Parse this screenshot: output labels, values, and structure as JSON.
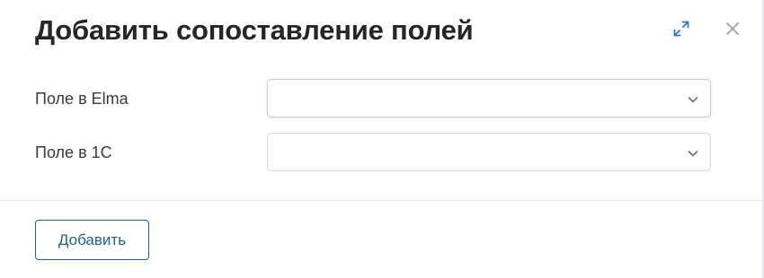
{
  "dialog": {
    "title": "Добавить сопоставление полей",
    "expand_icon": "expand-arrows-icon",
    "close_icon": "close-icon"
  },
  "fields": [
    {
      "label": "Поле в Elma",
      "value": "",
      "focused": true
    },
    {
      "label": "Поле в 1С",
      "value": "",
      "focused": false
    }
  ],
  "footer": {
    "add_label": "Добавить"
  },
  "colors": {
    "accent": "#1f5f96",
    "expand_icon": "#2f78c4",
    "close_icon": "#9aa1a9",
    "text": "#262626"
  }
}
